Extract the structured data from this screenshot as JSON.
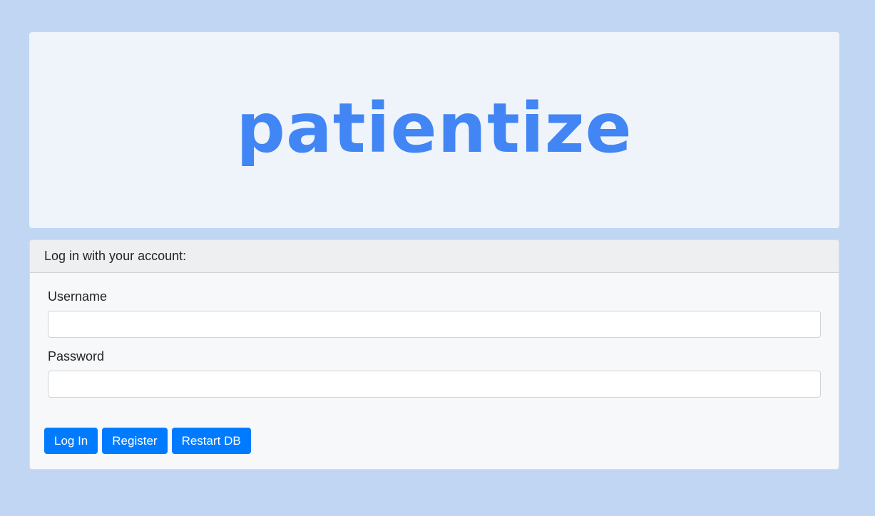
{
  "logo": {
    "text": "patientize",
    "color": "#4285f4"
  },
  "login": {
    "header": "Log in with your account:",
    "username_label": "Username",
    "username_value": "",
    "password_label": "Password",
    "password_value": ""
  },
  "buttons": {
    "login": "Log In",
    "register": "Register",
    "restart": "Restart DB"
  },
  "colors": {
    "page_background": "#c1d6f3",
    "button_primary": "#007bff"
  }
}
